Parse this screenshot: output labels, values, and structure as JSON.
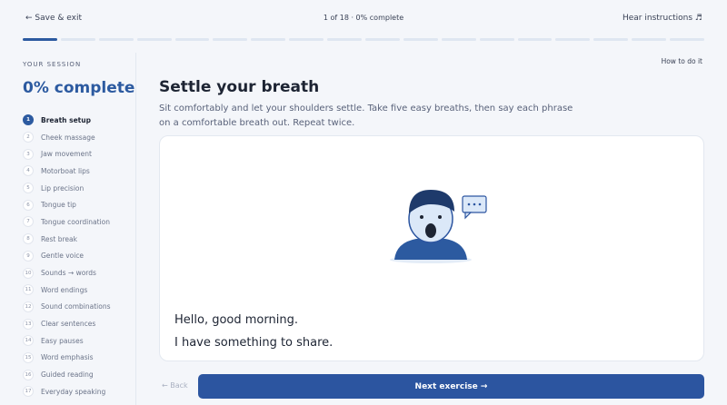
{
  "header": {
    "save_exit": "← Save & exit",
    "progress_text": "1 of 18 · 0% complete",
    "hear_instructions": "Hear instructions ♬"
  },
  "progress": {
    "total_segments": 18,
    "current_segment": 1,
    "accent_color": "#2c5aa0"
  },
  "sidebar": {
    "label": "YOUR SESSION",
    "complete": "0% complete",
    "steps": [
      {
        "num": "1",
        "label": "Breath setup",
        "active": true
      },
      {
        "num": "2",
        "label": "Cheek massage"
      },
      {
        "num": "3",
        "label": "Jaw movement"
      },
      {
        "num": "4",
        "label": "Motorboat lips"
      },
      {
        "num": "5",
        "label": "Lip precision"
      },
      {
        "num": "6",
        "label": "Tongue tip"
      },
      {
        "num": "7",
        "label": "Tongue coordination"
      },
      {
        "num": "8",
        "label": "Rest break"
      },
      {
        "num": "9",
        "label": "Gentle voice"
      },
      {
        "num": "10",
        "label": "Sounds → words"
      },
      {
        "num": "11",
        "label": "Word endings"
      },
      {
        "num": "12",
        "label": "Sound combinations"
      },
      {
        "num": "13",
        "label": "Clear sentences"
      },
      {
        "num": "14",
        "label": "Easy pauses"
      },
      {
        "num": "15",
        "label": "Word emphasis"
      },
      {
        "num": "16",
        "label": "Guided reading"
      },
      {
        "num": "17",
        "label": "Everyday speaking"
      }
    ]
  },
  "main": {
    "how_to": "How to do it",
    "title": "Settle your breath",
    "description": "Sit comfortably and let your shoulders settle. Take five easy breaths, then say each phrase on a comfortable breath out. Repeat twice.",
    "illustration_icon": "speaking-person-icon",
    "phrases": [
      "Hello, good morning.",
      "I have something to share."
    ]
  },
  "footer": {
    "back": "← Back",
    "next": "Next exercise →"
  }
}
